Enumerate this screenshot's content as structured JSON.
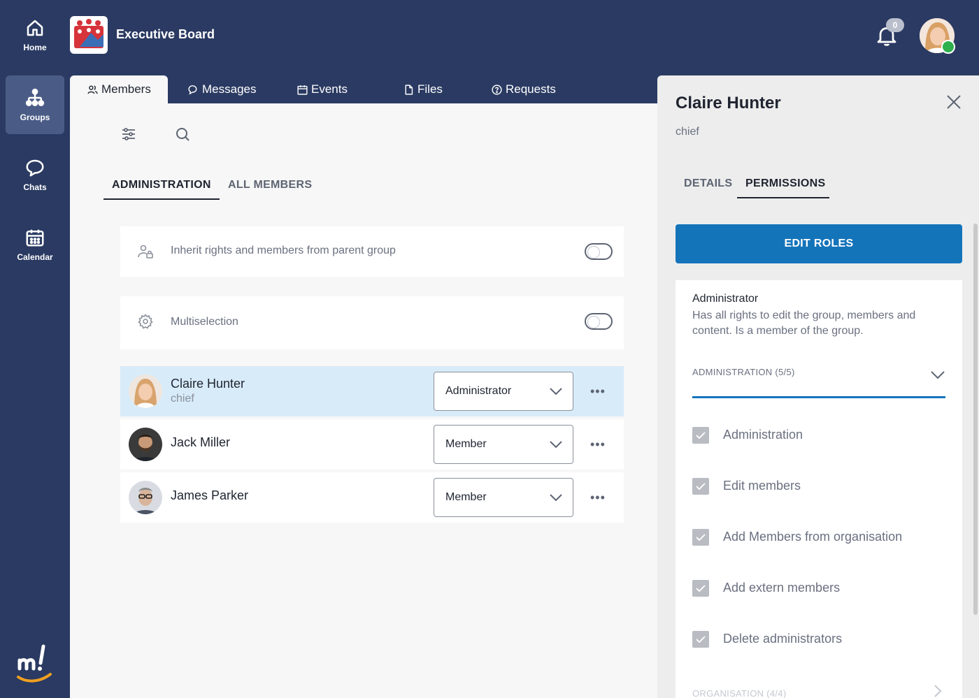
{
  "app": {
    "accent": "#1474ba",
    "nav_bg": "#2a3a62"
  },
  "rail": {
    "items": [
      {
        "label": "Home",
        "icon": "home-icon"
      },
      {
        "label": "Groups",
        "icon": "groups-icon",
        "active": true
      },
      {
        "label": "Chats",
        "icon": "chat-icon"
      },
      {
        "label": "Calendar",
        "icon": "calendar-icon"
      }
    ]
  },
  "header": {
    "group_title": "Executive Board",
    "notifications_count": "0"
  },
  "tabs": [
    {
      "label": "Members",
      "icon": "members-icon",
      "active": true
    },
    {
      "label": "Messages",
      "icon": "messages-icon"
    },
    {
      "label": "Events",
      "icon": "events-icon"
    },
    {
      "label": "Files",
      "icon": "files-icon"
    },
    {
      "label": "Requests",
      "icon": "requests-icon"
    }
  ],
  "main": {
    "subtabs": [
      {
        "label": "ADMINISTRATION",
        "active": true
      },
      {
        "label": "ALL MEMBERS"
      }
    ],
    "settings": [
      {
        "label": "Inherit rights and members from parent group",
        "icon": "user-lock-icon",
        "enabled": false
      },
      {
        "label": "Multiselection",
        "icon": "gear-icon",
        "enabled": false
      }
    ],
    "members": [
      {
        "name": "Claire Hunter",
        "subtitle": "chief",
        "role": "Administrator",
        "selected": true
      },
      {
        "name": "Jack Miller",
        "subtitle": "",
        "role": "Member"
      },
      {
        "name": "James Parker",
        "subtitle": "",
        "role": "Member"
      }
    ],
    "more_label": "•••"
  },
  "panel": {
    "name": "Claire Hunter",
    "subtitle": "chief",
    "tabs": [
      {
        "label": "DETAILS"
      },
      {
        "label": "PERMISSIONS",
        "active": true
      }
    ],
    "edit_roles_label": "EDIT ROLES",
    "role": {
      "name": "Administrator",
      "description": "Has all rights to edit the group, members and content. Is a member of the group."
    },
    "section": "ADMINISTRATION (5/5)",
    "permissions": [
      {
        "label": "Administration",
        "checked": true
      },
      {
        "label": "Edit members",
        "checked": true
      },
      {
        "label": "Add Members from organisation",
        "checked": true
      },
      {
        "label": "Add extern members",
        "checked": true
      },
      {
        "label": "Delete administrators",
        "checked": true
      }
    ],
    "next_section": "ORGANISATION (4/4)"
  }
}
